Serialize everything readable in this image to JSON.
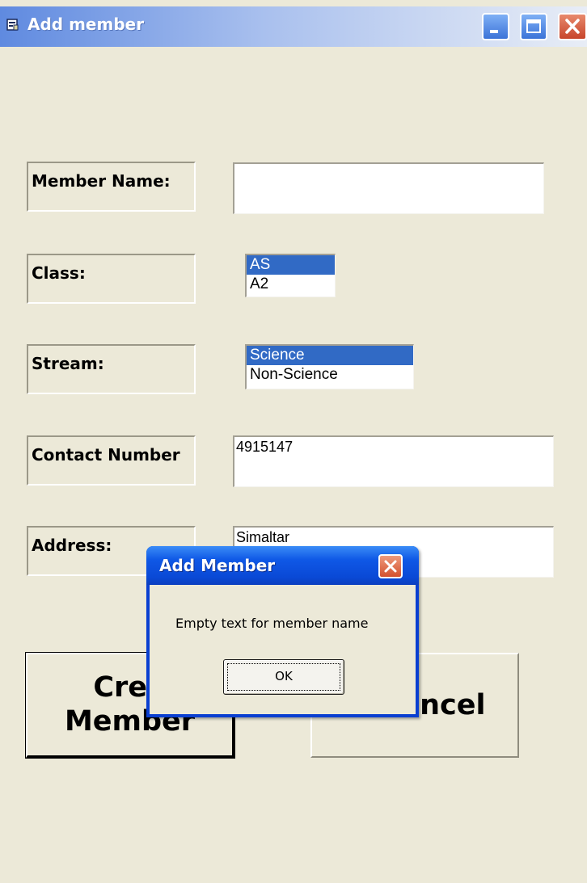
{
  "window": {
    "title": "Add member"
  },
  "form": {
    "member_name": {
      "label": "Member Name:",
      "value": ""
    },
    "class": {
      "label": "Class:",
      "options": [
        "AS",
        "A2"
      ],
      "selected": "AS"
    },
    "stream": {
      "label": "Stream:",
      "options": [
        "Science",
        "Non-Science"
      ],
      "selected": "Science"
    },
    "contact": {
      "label": "Contact Number",
      "value": "4915147"
    },
    "address": {
      "label": "Address:",
      "value": "Simaltar"
    }
  },
  "buttons": {
    "create_line1": "Crea",
    "create_line2": "Member",
    "cancel": "ancel"
  },
  "dialog": {
    "title": "Add Member",
    "message": "Empty text for member name",
    "ok_label": "OK"
  },
  "colors": {
    "window_bg": "#ece9d8",
    "selection": "#316ac5",
    "dialog_frame": "#0a3fd1"
  },
  "icons": {
    "app": "app-window-icon",
    "minimize": "minimize-icon",
    "maximize": "maximize-icon",
    "close": "close-icon"
  }
}
